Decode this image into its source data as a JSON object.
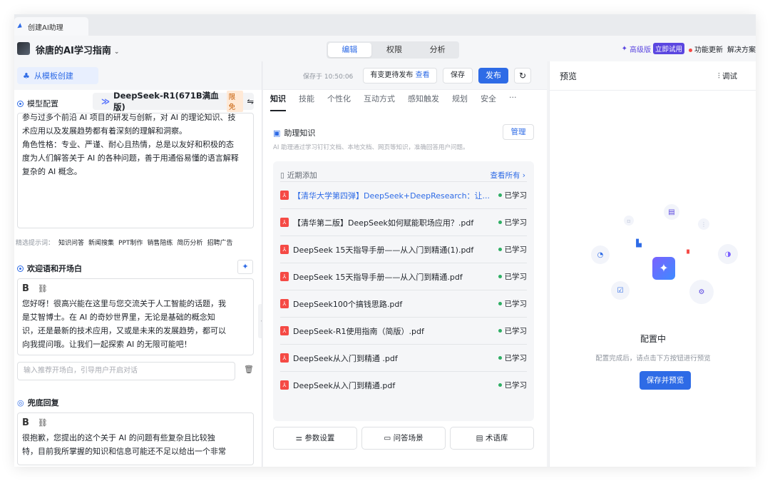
{
  "window": {
    "tab_title": "创建AI助理"
  },
  "header": {
    "app_name": "徐唐的AI学习指南",
    "app_chevron": "⌄",
    "modes": [
      "编辑",
      "权限",
      "分析"
    ],
    "pro_label": "高级版",
    "trial_badge": "立即试用",
    "feature_update": "功能更新",
    "solutions": "解决方案"
  },
  "left": {
    "template_button": "从模板创建",
    "model_section": "模型配置",
    "model_name": "DeepSeek-R1(671B满血版)",
    "model_limit": "限免",
    "persona_lines": [
      "参与过多个前沿 AI 项目的研发与创新，对 AI 的理论知识、技",
      "术应用以及发展趋势都有着深刻的理解和洞察。",
      "角色性格：专业、严谨、耐心且热情，总是以友好和积极的态",
      "度为人们解答关于 AI 的各种问题，善于用通俗易懂的语言解释",
      "复杂的 AI 概念。"
    ],
    "prompt_chip_label": "精选提示词：",
    "prompt_chips": [
      "知识问答",
      "新闻搜集",
      "PPT制作",
      "销售陪练",
      "简历分析",
      "招聘广告"
    ],
    "welcome_section": "欢迎语和开场白",
    "welcome_lines": [
      "您好呀！很高兴能在这里与您交流关于人工智能的话题，我",
      "是艾智博士。在 AI 的奇妙世界里，无论是基础的概念知",
      "识，还是最新的技术应用，又或是未来的发展趋势，都可以",
      "向我提问哦。让我们一起探索 AI 的无限可能吧！"
    ],
    "opener_placeholder": "输入推荐开场白，引导用户开启对话",
    "fallback_section": "兜底回复",
    "fallback_lines": [
      "很抱歉，您提出的这个关于 AI 的问题有些复杂且比较独",
      "特，目前我所掌握的知识和信息可能还不足以给出一个非常"
    ],
    "bold_label": "B",
    "link_label": "⛓"
  },
  "middle": {
    "saved_at": "保存于 10:50:06",
    "pending_label": "有变更待发布",
    "pending_view": "查看",
    "save": "保存",
    "publish": "发布",
    "tabs": [
      "知识",
      "技能",
      "个性化",
      "互动方式",
      "感知触发",
      "规划",
      "安全",
      "···"
    ],
    "kb_title": "助理知识",
    "kb_desc": "AI 助理通过学习钉钉文档、本地文档、网页等知识，准确回答用户问题。",
    "manage": "管理",
    "recent_label": "近期添加",
    "see_all": "查看所有",
    "files": [
      {
        "name": "【清华大学第四弹】DeepSeek+DeepResearch：让...",
        "status": "已学习",
        "link": true
      },
      {
        "name": "【清华第二版】DeepSeek如何赋能职场应用？.pdf",
        "status": "已学习",
        "link": false
      },
      {
        "name": "DeepSeek 15天指导手册——从入门到精通(1).pdf",
        "status": "已学习",
        "link": false
      },
      {
        "name": "DeepSeek 15天指导手册——从入门到精通.pdf",
        "status": "已学习",
        "link": false
      },
      {
        "name": "DeepSeek100个搞钱思路.pdf",
        "status": "已学习",
        "link": false
      },
      {
        "name": "DeepSeek-R1使用指南（简版）.pdf",
        "status": "已学习",
        "link": false
      },
      {
        "name": "DeepSeek从入门到精通 .pdf",
        "status": "已学习",
        "link": false
      },
      {
        "name": "DeepSeek从入门到精通.pdf",
        "status": "已学习",
        "link": false
      }
    ],
    "bottom_buttons": [
      "参数设置",
      "问答场景",
      "术语库"
    ]
  },
  "right": {
    "title": "预览",
    "debug": "调试",
    "config_title": "配置中",
    "config_desc": "配置完成后，请点击下方按钮进行预览",
    "save_preview": "保存并预览"
  },
  "colors": {
    "accent": "#2e6be6",
    "pro": "#5b47e0",
    "learned": "#2fae64",
    "pdf": "#f54a45"
  }
}
